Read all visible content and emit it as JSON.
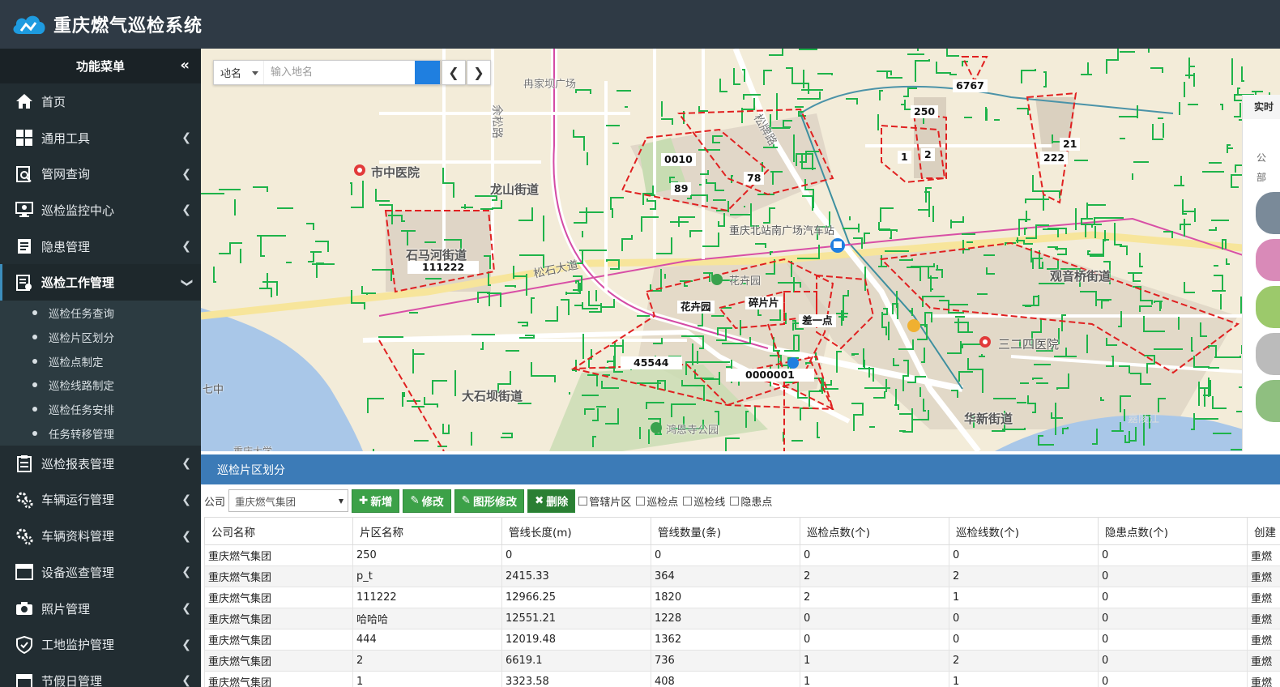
{
  "app": {
    "title": "重庆燃气巡检系统"
  },
  "sidebar": {
    "heading": "功能菜单",
    "collapse_glyph": "«",
    "items": [
      {
        "label": "首页",
        "icon": "home-icon"
      },
      {
        "label": "通用工具",
        "icon": "grid-icon"
      },
      {
        "label": "管网查询",
        "icon": "search-doc-icon"
      },
      {
        "label": "巡检监控中心",
        "icon": "monitor-icon"
      },
      {
        "label": "隐患管理",
        "icon": "document-icon"
      },
      {
        "label": "巡检工作管理",
        "icon": "task-icon"
      },
      {
        "label": "巡检报表管理",
        "icon": "clipboard-icon"
      },
      {
        "label": "车辆运行管理",
        "icon": "gears-icon"
      },
      {
        "label": "车辆资料管理",
        "icon": "gears-icon"
      },
      {
        "label": "设备巡查管理",
        "icon": "browser-icon"
      },
      {
        "label": "照片管理",
        "icon": "camera-icon"
      },
      {
        "label": "工地监护管理",
        "icon": "shield-icon"
      },
      {
        "label": "节假日管理",
        "icon": "calendar-icon"
      }
    ],
    "submenu": [
      "巡检任务查询",
      "巡检片区划分",
      "巡检点制定",
      "巡检线路制定",
      "巡检任务安排",
      "任务转移管理"
    ]
  },
  "map": {
    "search_type": "地名",
    "search_placeholder": "输入地名",
    "places": [
      "市中医院",
      "龙山街道",
      "石马河街道",
      "冉家坝广场",
      "大石坝街道",
      "花卉园",
      "观音桥街道",
      "三二四医院",
      "华新街道",
      "重庆北站南广场汽车站",
      "松石大道",
      "嘉陵江",
      "七中",
      "鸿恩寺公园",
      "松牌路",
      "余松路",
      "重庆大学"
    ],
    "zone_labels": [
      "6767",
      "250",
      "1",
      "2",
      "21",
      "222",
      "0010",
      "89",
      "78",
      "111222",
      "花卉园",
      "碎片片",
      "差一点",
      "45544",
      "0000001"
    ],
    "right_panel_title": "实时",
    "right_panel_lines": [
      "公",
      "部"
    ]
  },
  "panel": {
    "title": "巡检片区划分",
    "company_label": "公司",
    "company_value": "重庆燃气集团",
    "buttons": {
      "add": "新增",
      "edit": "修改",
      "shape_edit": "图形修改",
      "delete": "删除"
    },
    "checkboxes": [
      "管辖片区",
      "巡检点",
      "巡检线",
      "隐患点"
    ]
  },
  "table": {
    "headers": [
      "公司名称",
      "片区名称",
      "管线长度(m)",
      "管线数量(条)",
      "巡检点数(个)",
      "巡检线数(个)",
      "隐患点数(个)",
      "创建"
    ],
    "rows": [
      [
        "重庆燃气集团",
        "250",
        "0",
        "0",
        "0",
        "0",
        "0",
        "重燃"
      ],
      [
        "重庆燃气集团",
        "p_t",
        "2415.33",
        "364",
        "2",
        "2",
        "0",
        "重燃"
      ],
      [
        "重庆燃气集团",
        "111222",
        "12966.25",
        "1820",
        "2",
        "1",
        "0",
        "重燃"
      ],
      [
        "重庆燃气集团",
        "哈哈哈",
        "12551.21",
        "1228",
        "0",
        "0",
        "0",
        "重燃"
      ],
      [
        "重庆燃气集团",
        "444",
        "12019.48",
        "1362",
        "0",
        "0",
        "0",
        "重燃"
      ],
      [
        "重庆燃气集团",
        "2",
        "6619.1",
        "736",
        "1",
        "2",
        "0",
        "重燃"
      ],
      [
        "重庆燃气集团",
        "1",
        "3323.58",
        "408",
        "1",
        "1",
        "0",
        "重燃"
      ]
    ]
  }
}
